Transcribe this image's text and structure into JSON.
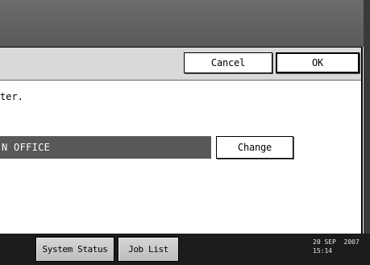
{
  "dialog": {
    "cancel_label": "Cancel",
    "ok_label": "OK",
    "message_text": "ter.",
    "current_value": "N OFFICE",
    "change_label": "Change"
  },
  "taskbar": {
    "system_status_label": "System Status",
    "job_list_label": "Job List",
    "date": "20 SEP  2007",
    "time": "15:14"
  },
  "colors": {
    "title_bar": "#6c6c6c",
    "header_band": "#d9d9d9",
    "selected_value_bar": "#585858",
    "taskbar": "#1c1c1c",
    "button_face": "#ffffff"
  }
}
